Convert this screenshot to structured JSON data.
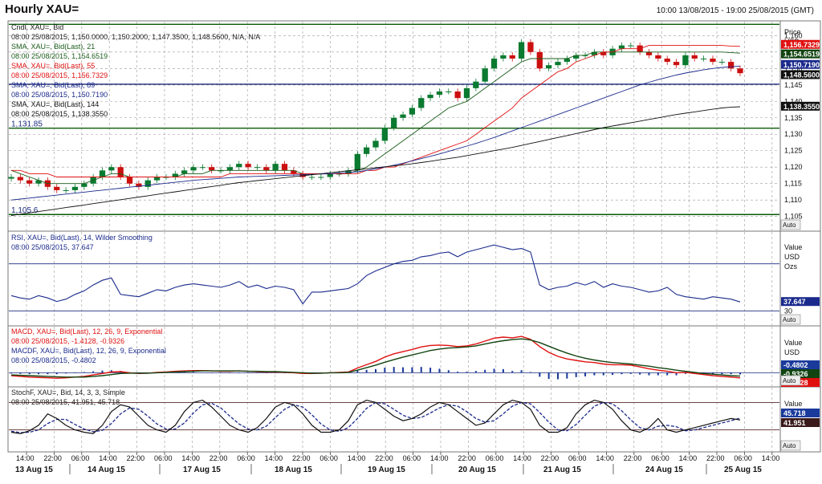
{
  "header": {
    "title": "Hourly XAU=",
    "range": "10:00 13/08/2015 - 19:00 25/08/2015 (GMT)"
  },
  "colors": {
    "price_sma21": "#1a5c1a",
    "price_sma55": "#e01010",
    "price_sma89": "#1a2a8c",
    "price_sma144": "#111111",
    "candle_up": "#0a7a30",
    "candle_down": "#cc1010",
    "hline_green": "#0a5a0a",
    "hline_blue": "#1a2a7c",
    "rsi_line": "#1a2a8c",
    "macd": "#e01010",
    "signal": "#114411",
    "hist": "#1a3a9c",
    "stoch_k": "#111111",
    "stoch_d": "#1a2a8c"
  },
  "price_panel": {
    "legend": [
      "Cndl, XAU=, Bid",
      "08:00 25/08/2015, 1,150.0000, 1,150.2000, 1,147.3500, 1,148.5600, N/A, N/A",
      "SMA, XAU=, Bid(Last), 21",
      "08:00 25/08/2015, 1,154.6519",
      "SMA, XAU=, Bid(Last), 55",
      "08:00 25/08/2015, 1,156.7329",
      "SMA, XAU=, Bid(Last), 89",
      "08:00 25/08/2015, 1,150.7190",
      "SMA, XAU=, Bid(Last), 144",
      "08:00 25/08/2015, 1,138.3550"
    ],
    "axis_header": [
      "Price",
      "USD"
    ],
    "ticks": [
      "1,160",
      "1,155",
      "1,150",
      "1,145",
      "1,140",
      "1,135",
      "1,130",
      "1,125",
      "1,120",
      "1,115",
      "1,110",
      "1,105"
    ],
    "level_labels": [
      "1,131.85",
      "1,105.6"
    ],
    "price_tags": [
      {
        "text": "1,156.7329",
        "color": "#e01010",
        "text_color": "#ffffff"
      },
      {
        "text": "1,154.6519",
        "color": "#114411",
        "text_color": "#ffffff"
      },
      {
        "text": "1,150.7190",
        "color": "#1a2a8c",
        "text_color": "#ffffff"
      },
      {
        "text": "1,148.5600",
        "color": "#111111",
        "text_color": "#ffffff"
      },
      {
        "text": "1,138.3550",
        "color": "#111111",
        "text_color": "#ffffff"
      }
    ],
    "auto_label": "Auto"
  },
  "rsi_panel": {
    "legend": [
      "RSI, XAU=, Bid(Last), 14, Wilder Smoothing",
      "08:00 25/08/2015, 37.647"
    ],
    "axis_header": [
      "Value",
      "USD",
      "Ozs"
    ],
    "ticks": [
      "30"
    ],
    "value_tag": "37.647",
    "auto_label": "Auto"
  },
  "macd_panel": {
    "legend": [
      "MACD, XAU=, Bid(Last), 12, 26, 9, Exponential",
      "08:00 25/08/2015, -1.4128, -0.9326",
      "MACDF, XAU=, Bid(Last), 12, 26, 9, Exponential",
      "08:00 25/08/2015, -0.4802"
    ],
    "axis_header": [
      "Value",
      "USD"
    ],
    "value_tags": [
      "-0.4802",
      "-0.9326",
      "-1.4128"
    ],
    "auto_label": "Auto"
  },
  "stoch_panel": {
    "legend": [
      "StochF, XAU=, Bid, 14, 3, 3, Simple",
      "08:00 25/08/2015, 41.951, 45.718"
    ],
    "axis_header": [
      "Value"
    ],
    "value_tags": [
      "45.718",
      "41.951"
    ],
    "auto_label": "Auto"
  },
  "time_axis": {
    "hour_ticks": [
      "14:00",
      "22:00",
      "06:00",
      "14:00",
      "22:00",
      "06:00",
      "14:00",
      "22:00",
      "06:00",
      "14:00",
      "22:00",
      "06:00",
      "14:00",
      "22:00",
      "06:00",
      "14:00",
      "22:00",
      "06:00",
      "14:00",
      "22:00",
      "06:00",
      "14:00",
      "22:00",
      "06:00",
      "14:00",
      "22:00",
      "06:00",
      "14:00"
    ],
    "dates": [
      "13 Aug 15",
      "14 Aug 15",
      "17 Aug 15",
      "18 Aug 15",
      "19 Aug 15",
      "20 Aug 15",
      "21 Aug 15",
      "24 Aug 15",
      "25 Aug 15"
    ]
  },
  "chart_data": {
    "type": "line",
    "series": [
      {
        "name": "Cndl, XAU=, Bid",
        "values": [
          1117,
          1116,
          1115,
          1116,
          1114,
          1113,
          1113,
          1114,
          1115,
          1117,
          1119,
          1120,
          1117,
          1115,
          1114,
          1116,
          1117,
          1117,
          1118,
          1119,
          1120,
          1120,
          1119,
          1119,
          1120,
          1121,
          1120,
          1120,
          1119,
          1121,
          1119,
          1118,
          1117,
          1117,
          1117,
          1118,
          1118,
          1119,
          1124,
          1126,
          1128,
          1132,
          1135,
          1136,
          1138,
          1141,
          1142,
          1143,
          1143,
          1141,
          1144,
          1146,
          1150,
          1153,
          1154,
          1153,
          1158,
          1155,
          1150,
          1151,
          1152,
          1153,
          1154,
          1154,
          1155,
          1154,
          1156,
          1157,
          1157,
          1155,
          1154,
          1153,
          1152,
          1151,
          1154,
          1153,
          1153,
          1152,
          1152,
          1150,
          1148.56
        ]
      },
      {
        "name": "SMA, XAU=, Bid(Last), 21",
        "values": [
          1119,
          1118,
          1117,
          1116,
          1115,
          1115,
          1115,
          1115,
          1115,
          1116,
          1117,
          1118,
          1118,
          1117,
          1117,
          1117,
          1117,
          1117,
          1117,
          1118,
          1118,
          1118,
          1119,
          1119,
          1119,
          1119,
          1119,
          1119,
          1119,
          1119,
          1119,
          1119,
          1118,
          1118,
          1118,
          1118,
          1118,
          1118,
          1119,
          1120,
          1122,
          1124,
          1126,
          1128,
          1130,
          1132,
          1134,
          1136,
          1138,
          1139,
          1140,
          1142,
          1144,
          1146,
          1148,
          1150,
          1152,
          1153,
          1153,
          1153,
          1153,
          1153,
          1154,
          1154,
          1155,
          1155,
          1155,
          1155,
          1155,
          1155,
          1155,
          1155,
          1155,
          1155,
          1155,
          1155,
          1155,
          1155,
          1155,
          1154.8,
          1154.65
        ]
      },
      {
        "name": "SMA, XAU=, Bid(Last), 55",
        "values": [
          1119,
          1119,
          1118,
          1118,
          1118,
          1117,
          1117,
          1117,
          1117,
          1117,
          1117,
          1117,
          1117,
          1117,
          1117,
          1117,
          1117,
          1117,
          1117,
          1117,
          1117,
          1117,
          1117,
          1117,
          1118,
          1118,
          1118,
          1118,
          1118,
          1118,
          1118,
          1118,
          1118,
          1118,
          1118,
          1118,
          1118,
          1118,
          1118,
          1119,
          1119,
          1120,
          1120,
          1121,
          1122,
          1123,
          1124,
          1125,
          1126,
          1127,
          1128,
          1130,
          1132,
          1134,
          1136,
          1138,
          1141,
          1143,
          1145,
          1147,
          1149,
          1150,
          1152,
          1153,
          1154,
          1155,
          1155,
          1156,
          1156,
          1156,
          1157,
          1157,
          1157,
          1157,
          1157,
          1157,
          1157,
          1157,
          1157,
          1156.8,
          1156.73
        ]
      },
      {
        "name": "SMA, XAU=, Bid(Last), 89",
        "values": [
          1110,
          1110.3,
          1110.6,
          1110.9,
          1111.2,
          1111.5,
          1111.8,
          1112.1,
          1112.4,
          1112.7,
          1113,
          1113.3,
          1113.6,
          1113.9,
          1114.2,
          1114.5,
          1114.8,
          1115.1,
          1115.4,
          1115.7,
          1116,
          1116.2,
          1116.4,
          1116.6,
          1116.8,
          1117,
          1117.1,
          1117.2,
          1117.3,
          1117.4,
          1117.5,
          1117.6,
          1117.7,
          1117.8,
          1117.9,
          1118,
          1118.2,
          1118.4,
          1118.6,
          1119,
          1119.5,
          1120,
          1120.6,
          1121.2,
          1121.9,
          1122.6,
          1123.3,
          1124,
          1124.8,
          1125.6,
          1126.4,
          1127.2,
          1128.1,
          1129,
          1130,
          1131,
          1132,
          1133,
          1134,
          1135,
          1136,
          1137,
          1138,
          1139,
          1140,
          1141,
          1142,
          1143,
          1144,
          1145,
          1145.8,
          1146.6,
          1147.3,
          1148,
          1148.6,
          1149.1,
          1149.6,
          1150,
          1150.3,
          1150.5,
          1150.72
        ]
      },
      {
        "name": "SMA, XAU=, Bid(Last), 144",
        "values": [
          1105.3,
          1105.7,
          1106.1,
          1106.5,
          1106.9,
          1107.3,
          1107.7,
          1108.1,
          1108.5,
          1108.9,
          1109.3,
          1109.7,
          1110.1,
          1110.5,
          1110.9,
          1111.3,
          1111.7,
          1112.1,
          1112.5,
          1112.9,
          1113.3,
          1113.7,
          1114.1,
          1114.5,
          1114.9,
          1115.3,
          1115.6,
          1115.9,
          1116.2,
          1116.5,
          1116.8,
          1117.1,
          1117.4,
          1117.7,
          1118,
          1118.3,
          1118.6,
          1118.9,
          1119.2,
          1119.5,
          1119.8,
          1120.1,
          1120.4,
          1120.7,
          1121,
          1121.4,
          1121.8,
          1122.2,
          1122.6,
          1123,
          1123.5,
          1124,
          1124.5,
          1125,
          1125.5,
          1126,
          1126.6,
          1127.2,
          1127.8,
          1128.4,
          1129,
          1129.6,
          1130.2,
          1130.8,
          1131.4,
          1132,
          1132.5,
          1133,
          1133.5,
          1134,
          1134.5,
          1135,
          1135.5,
          1136,
          1136.4,
          1136.8,
          1137.2,
          1137.6,
          1138,
          1138.2,
          1138.36
        ]
      },
      {
        "name": "RSI, XAU=, Bid(Last), 14, Wilder Smoothing",
        "values": [
          43,
          41,
          40,
          43,
          41,
          38,
          40,
          44,
          47,
          52,
          56,
          58,
          44,
          43,
          42,
          45,
          48,
          47,
          50,
          52,
          53,
          52,
          51,
          50,
          52,
          55,
          50,
          52,
          49,
          51,
          50,
          48,
          36,
          46,
          46,
          47,
          48,
          49,
          53,
          60,
          64,
          67,
          70,
          72,
          73,
          76,
          77,
          79,
          80,
          76,
          80,
          82,
          84,
          86,
          84,
          82,
          83,
          80,
          52,
          48,
          50,
          51,
          54,
          52,
          55,
          50,
          53,
          51,
          50,
          48,
          46,
          47,
          50,
          44,
          42,
          41,
          40,
          42,
          41,
          40,
          37.6
        ]
      },
      {
        "name": "MACD, XAU=, Bid(Last), 12, 26, 9, Exponential",
        "values": [
          -0.8,
          -1,
          -1.2,
          -1.3,
          -1.4,
          -1.5,
          -1.4,
          -1.2,
          -1,
          -0.6,
          -0.2,
          0.2,
          0.3,
          0,
          -0.2,
          -0.1,
          0.1,
          0.2,
          0.4,
          0.5,
          0.6,
          0.6,
          0.5,
          0.4,
          0.4,
          0.5,
          0.4,
          0.3,
          0.2,
          0.2,
          0.1,
          0,
          -0.2,
          -0.2,
          -0.1,
          0,
          0.1,
          0.2,
          1.3,
          2.2,
          3.1,
          4.3,
          5.2,
          5.8,
          6.4,
          7.1,
          7.5,
          7.6,
          7.5,
          7.2,
          7.4,
          7.9,
          8.7,
          9.5,
          9.8,
          9.6,
          10,
          9.2,
          7.2,
          5.6,
          4.5,
          3.8,
          3.4,
          3,
          2.8,
          2.4,
          2.2,
          2.2,
          2.1,
          1.6,
          1.1,
          0.7,
          0.4,
          0,
          0.1,
          -0.2,
          -0.5,
          -0.8,
          -1,
          -1.2,
          -1.41
        ]
      },
      {
        "name": "MACD signal",
        "values": [
          -0.6,
          -0.7,
          -0.8,
          -0.9,
          -1,
          -1.1,
          -1.2,
          -1.2,
          -1.2,
          -1,
          -0.8,
          -0.5,
          -0.2,
          -0.1,
          -0.1,
          -0.1,
          0,
          0.1,
          0.2,
          0.3,
          0.4,
          0.5,
          0.5,
          0.5,
          0.5,
          0.5,
          0.4,
          0.4,
          0.3,
          0.3,
          0.2,
          0.1,
          0,
          -0.1,
          -0.1,
          0,
          0,
          0.1,
          0.7,
          1.4,
          2.1,
          2.9,
          3.6,
          4.3,
          4.9,
          5.5,
          6.1,
          6.5,
          6.8,
          6.9,
          7.1,
          7.4,
          7.9,
          8.4,
          8.8,
          9.1,
          9.3,
          9,
          8.3,
          7.3,
          6.3,
          5.4,
          4.6,
          4,
          3.5,
          3.1,
          2.8,
          2.6,
          2.4,
          2.1,
          1.8,
          1.4,
          1.1,
          0.7,
          0.4,
          0.1,
          -0.2,
          -0.4,
          -0.6,
          -0.8,
          -0.93
        ]
      },
      {
        "name": "MACDF, XAU=, Bid(Last), 12, 26, 9, Exponential",
        "values": [
          -0.2,
          -0.3,
          -0.4,
          -0.4,
          -0.4,
          -0.4,
          -0.2,
          0,
          0.2,
          0.4,
          0.6,
          0.7,
          0.5,
          0.1,
          -0.1,
          0,
          0.1,
          0.1,
          0.2,
          0.2,
          0.2,
          0.1,
          0,
          -0.1,
          -0.1,
          0,
          0,
          -0.1,
          -0.1,
          -0.1,
          -0.1,
          -0.1,
          -0.2,
          -0.1,
          0,
          0,
          0.1,
          0.1,
          0.6,
          0.8,
          1,
          1.4,
          1.6,
          1.5,
          1.5,
          1.6,
          1.4,
          1.1,
          0.7,
          0.3,
          0.3,
          0.5,
          0.8,
          1.1,
          1,
          0.5,
          0.7,
          0.2,
          -1.1,
          -1.7,
          -1.8,
          -1.6,
          -1.2,
          -1,
          -0.7,
          -0.7,
          -0.6,
          -0.4,
          -0.3,
          -0.5,
          -0.7,
          -0.7,
          -0.7,
          -0.7,
          -0.3,
          -0.3,
          -0.3,
          -0.4,
          -0.4,
          -0.4,
          -0.48
        ]
      },
      {
        "name": "StochF, XAU=, Bid, 14, 3, 3, Simple",
        "values": [
          15,
          12,
          18,
          30,
          55,
          45,
          30,
          20,
          15,
          12,
          30,
          60,
          75,
          70,
          50,
          30,
          20,
          15,
          30,
          60,
          80,
          85,
          70,
          50,
          30,
          20,
          15,
          25,
          45,
          70,
          80,
          75,
          55,
          30,
          15,
          15,
          20,
          40,
          75,
          85,
          80,
          65,
          50,
          40,
          45,
          55,
          70,
          80,
          75,
          60,
          45,
          30,
          35,
          55,
          75,
          85,
          80,
          65,
          30,
          15,
          15,
          25,
          55,
          75,
          85,
          80,
          65,
          40,
          20,
          15,
          25,
          45,
          20,
          15,
          20,
          25,
          30,
          35,
          40,
          45,
          41.95
        ]
      },
      {
        "name": "StochF %D",
        "values": [
          17,
          14,
          15,
          20,
          34,
          43,
          43,
          32,
          22,
          16,
          19,
          34,
          55,
          68,
          65,
          50,
          33,
          22,
          22,
          35,
          57,
          75,
          78,
          68,
          50,
          33,
          22,
          20,
          28,
          47,
          65,
          75,
          70,
          53,
          33,
          20,
          17,
          25,
          45,
          67,
          80,
          77,
          65,
          52,
          45,
          47,
          57,
          68,
          75,
          72,
          60,
          45,
          37,
          40,
          55,
          72,
          80,
          77,
          58,
          37,
          20,
          18,
          32,
          52,
          72,
          80,
          77,
          62,
          42,
          25,
          20,
          28,
          30,
          27,
          18,
          20,
          25,
          30,
          35,
          40,
          45.72
        ]
      }
    ],
    "ylim": [
      1102,
      1163
    ],
    "rsi_ylim": [
      20,
      95
    ],
    "macd_ylim": [
      -3,
      12
    ],
    "stoch_ylim": [
      0,
      100
    ],
    "levels": [
      1131.85,
      1105.6,
      1145.2,
      1163.4
    ],
    "rsi_levels": [
      30,
      70
    ],
    "stoch_levels": [
      20,
      80
    ],
    "grid": true
  }
}
